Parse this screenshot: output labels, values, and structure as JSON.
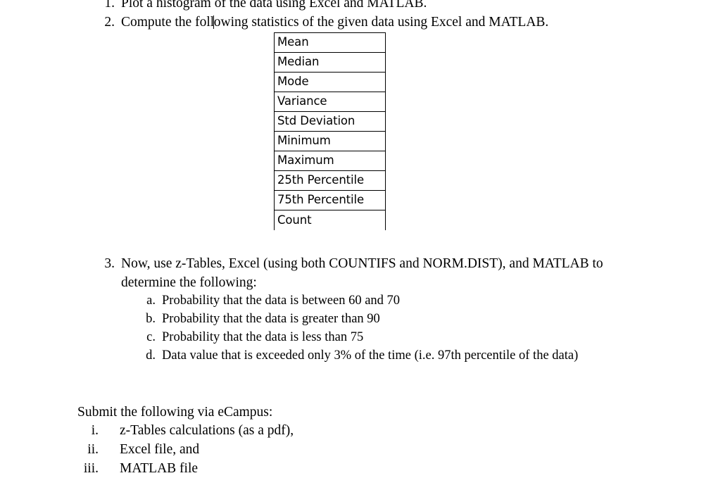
{
  "document": {
    "background_color": "#ffffff",
    "text_color": "#000000",
    "spellcheck_underline_color": "#e8241a"
  },
  "instructions": {
    "item1": {
      "marker": "1.",
      "text": "Plot a histogram of the data using Excel and MATLAB."
    },
    "item2": {
      "marker": "2.",
      "text_before_caret": "Compute the foll",
      "text_after_caret": "owing statistics of the given data using Excel and MATLAB.",
      "caret_visible": true
    },
    "item3": {
      "marker": "3.",
      "line1": "Now, use z-Tables, Excel (using both COUNTIFS and NORM.DIST), and MATLAB to",
      "line2": "determine the following:"
    },
    "subitems": [
      {
        "marker": "a.",
        "text": "Probability that the data is between 60 and 70"
      },
      {
        "marker": "b.",
        "text": "Probability that the data is greater than 90"
      },
      {
        "marker": "c.",
        "text": "Probability that the data is less than 75"
      },
      {
        "marker": "d.",
        "text": "Data value that is exceeded only 3% of the time (i.e. 97th percentile of the data)"
      }
    ]
  },
  "stats_table": {
    "rows": [
      "Mean",
      "Median",
      "Mode",
      "Variance",
      "Std Deviation",
      "Minimum",
      "Maximum",
      "25th Percentile",
      "75th Percentile",
      "Count"
    ]
  },
  "submission": {
    "lead_prefix": "Submit the following via ",
    "lead_misspelled_word": "eCampus",
    "lead_suffix": ":",
    "items": [
      {
        "marker": "i.",
        "text": "z-Tables calculations (as a pdf),"
      },
      {
        "marker": "ii.",
        "text": "Excel file, and"
      },
      {
        "marker": "iii.",
        "text": "MATLAB file"
      }
    ]
  }
}
